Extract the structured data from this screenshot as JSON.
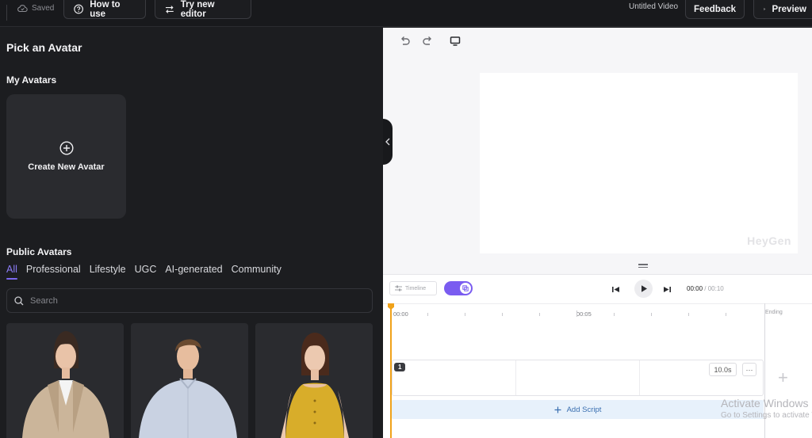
{
  "topbar": {
    "saved_label": "Saved",
    "how_to_use_label": "How to use",
    "try_editor_label": "Try new editor",
    "video_title": "Untitled Video",
    "feedback_label": "Feedback",
    "preview_label": "Preview"
  },
  "left_panel": {
    "heading": "Pick an Avatar",
    "my_avatars_heading": "My Avatars",
    "create_avatar_label": "Create New Avatar",
    "public_avatars_heading": "Public Avatars",
    "tabs": [
      {
        "label": "All",
        "active": true
      },
      {
        "label": "Professional",
        "active": false
      },
      {
        "label": "Lifestyle",
        "active": false
      },
      {
        "label": "UGC",
        "active": false
      },
      {
        "label": "AI-generated",
        "active": false
      },
      {
        "label": "Community",
        "active": false
      }
    ],
    "search": {
      "placeholder": "Search",
      "value": ""
    }
  },
  "canvas": {
    "watermark": "HeyGen"
  },
  "timeline": {
    "timeline_button_label": "Timeline",
    "toggle_on": true,
    "current_time": "00:00",
    "separator": "/ 00:10",
    "ruler_labels": [
      "00:00",
      "00:05"
    ],
    "ending_label": "Ending",
    "scene_number": "1",
    "scene_duration": "10.0s",
    "more_label": "···",
    "add_script_label": "Add Script"
  },
  "os_overlay": {
    "line1": "Activate Windows",
    "line2": "Go to Settings to activate Windows."
  },
  "colors": {
    "accent": "#7b68ee",
    "toggle": "#7a5cf0",
    "playhead": "#f0a21a",
    "add_script_bg": "#e7f1fb",
    "add_script_text": "#3a6fb0"
  }
}
